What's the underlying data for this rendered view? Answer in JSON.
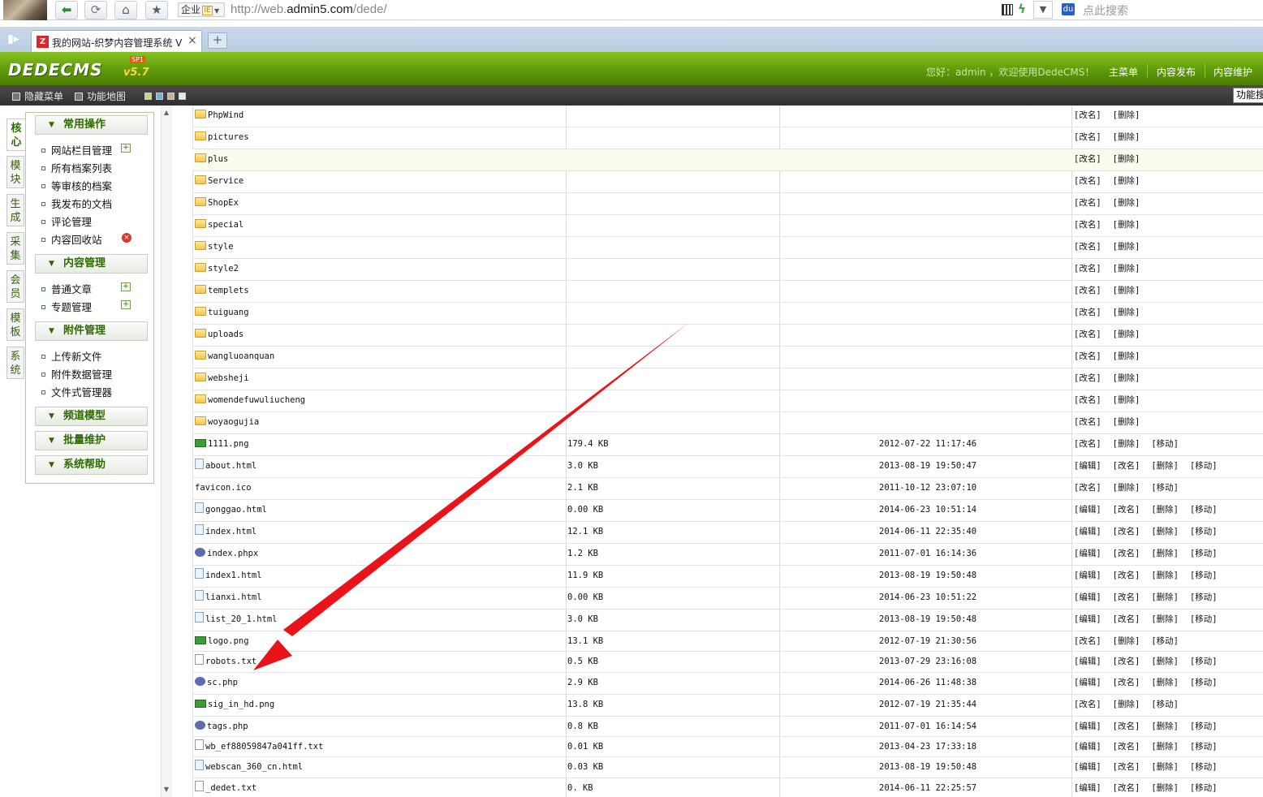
{
  "browser": {
    "url_prefix": "http://web.",
    "url_domain": "admin5.com",
    "url_suffix": "/dede/",
    "mode_label": "企业",
    "mode_ie": "IE",
    "search_placeholder": "点此搜索",
    "tab_title": "我的网站-织梦内容管理系统 V",
    "tab_close": "×",
    "new_tab": "+"
  },
  "header": {
    "logo": "DEDECMS",
    "version": "v5.7",
    "sp": "SP1",
    "welcome": "您好：admin ，欢迎使用DedeCMS！",
    "menus": [
      "主菜单",
      "内容发布",
      "内容维护"
    ]
  },
  "toolbar": {
    "hide_menu": "隐藏菜单",
    "func_map": "功能地图",
    "func_search": "功能搜",
    "skin_colors": [
      "#c8d86a",
      "#6eb4e6",
      "#c9b48a",
      "#e8e8e8"
    ]
  },
  "side_tabs": [
    "核心",
    "模块",
    "生成",
    "采集",
    "会员",
    "模板",
    "系统"
  ],
  "menu_groups": [
    {
      "title": "常用操作",
      "items": [
        "网站栏目管理",
        "所有档案列表",
        "等审核的档案",
        "我发布的文档",
        "评论管理",
        "内容回收站"
      ]
    },
    {
      "title": "内容管理",
      "items": [
        "普通文章",
        "专题管理"
      ]
    },
    {
      "title": "附件管理",
      "items": [
        "上传新文件",
        "附件数据管理",
        "文件式管理器"
      ]
    },
    {
      "title": "频道模型",
      "items": []
    },
    {
      "title": "批量维护",
      "items": []
    },
    {
      "title": "系统帮助",
      "items": []
    }
  ],
  "ops": {
    "edit": "[编辑]",
    "rename": "[改名]",
    "delete": "[删除]",
    "move": "[移动]"
  },
  "files": [
    {
      "name": "PhpWind",
      "type": "folder",
      "size": "",
      "date": "",
      "ops": [
        "rename",
        "delete"
      ]
    },
    {
      "name": "pictures",
      "type": "folder",
      "size": "",
      "date": "",
      "ops": [
        "rename",
        "delete"
      ]
    },
    {
      "name": "plus",
      "type": "folder",
      "size": "",
      "date": "",
      "ops": [
        "rename",
        "delete"
      ],
      "highlight": true
    },
    {
      "name": "Service",
      "type": "folder",
      "size": "",
      "date": "",
      "ops": [
        "rename",
        "delete"
      ]
    },
    {
      "name": "ShopEx",
      "type": "folder",
      "size": "",
      "date": "",
      "ops": [
        "rename",
        "delete"
      ]
    },
    {
      "name": "special",
      "type": "folder",
      "size": "",
      "date": "",
      "ops": [
        "rename",
        "delete"
      ]
    },
    {
      "name": "style",
      "type": "folder",
      "size": "",
      "date": "",
      "ops": [
        "rename",
        "delete"
      ]
    },
    {
      "name": "style2",
      "type": "folder",
      "size": "",
      "date": "",
      "ops": [
        "rename",
        "delete"
      ]
    },
    {
      "name": "templets",
      "type": "folder",
      "size": "",
      "date": "",
      "ops": [
        "rename",
        "delete"
      ]
    },
    {
      "name": "tuiguang",
      "type": "folder",
      "size": "",
      "date": "",
      "ops": [
        "rename",
        "delete"
      ]
    },
    {
      "name": "uploads",
      "type": "folder",
      "size": "",
      "date": "",
      "ops": [
        "rename",
        "delete"
      ]
    },
    {
      "name": "wangluoanquan",
      "type": "folder",
      "size": "",
      "date": "",
      "ops": [
        "rename",
        "delete"
      ]
    },
    {
      "name": "websheji",
      "type": "folder",
      "size": "",
      "date": "",
      "ops": [
        "rename",
        "delete"
      ]
    },
    {
      "name": "womendefuwuliucheng",
      "type": "folder",
      "size": "",
      "date": "",
      "ops": [
        "rename",
        "delete"
      ]
    },
    {
      "name": "woyaogujia",
      "type": "folder",
      "size": "",
      "date": "",
      "ops": [
        "rename",
        "delete"
      ]
    },
    {
      "name": "1111.png",
      "type": "gif",
      "size": "179.4 KB",
      "date": "2012-07-22 11:17:46",
      "ops": [
        "rename",
        "delete",
        "move"
      ]
    },
    {
      "name": "about.html",
      "type": "html",
      "size": "3.0 KB",
      "date": "2013-08-19 19:50:47",
      "ops": [
        "edit",
        "rename",
        "delete",
        "move"
      ]
    },
    {
      "name": "favicon.ico",
      "type": "none",
      "size": "2.1 KB",
      "date": "2011-10-12 23:07:10",
      "ops": [
        "rename",
        "delete",
        "move"
      ]
    },
    {
      "name": "gonggao.html",
      "type": "html",
      "size": "0.00 KB",
      "date": "2014-06-23 10:51:14",
      "ops": [
        "edit",
        "rename",
        "delete",
        "move"
      ]
    },
    {
      "name": "index.html",
      "type": "html",
      "size": "12.1 KB",
      "date": "2014-06-11 22:35:40",
      "ops": [
        "edit",
        "rename",
        "delete",
        "move"
      ]
    },
    {
      "name": "index.phpx",
      "type": "php",
      "size": "1.2 KB",
      "date": "2011-07-01 16:14:36",
      "ops": [
        "edit",
        "rename",
        "delete",
        "move"
      ]
    },
    {
      "name": "index1.html",
      "type": "html",
      "size": "11.9 KB",
      "date": "2013-08-19 19:50:48",
      "ops": [
        "edit",
        "rename",
        "delete",
        "move"
      ]
    },
    {
      "name": "lianxi.html",
      "type": "html",
      "size": "0.00 KB",
      "date": "2014-06-23 10:51:22",
      "ops": [
        "edit",
        "rename",
        "delete",
        "move"
      ]
    },
    {
      "name": "list_20_1.html",
      "type": "html",
      "size": "3.0 KB",
      "date": "2013-08-19 19:50:48",
      "ops": [
        "edit",
        "rename",
        "delete",
        "move"
      ]
    },
    {
      "name": "logo.png",
      "type": "gif",
      "size": "13.1 KB",
      "date": "2012-07-19 21:30:56",
      "ops": [
        "rename",
        "delete",
        "move"
      ]
    },
    {
      "name": "robots.txt",
      "type": "txt",
      "size": "0.5 KB",
      "date": "2013-07-29 23:16:08",
      "ops": [
        "edit",
        "rename",
        "delete",
        "move"
      ]
    },
    {
      "name": "sc.php",
      "type": "php",
      "size": "2.9 KB",
      "date": "2014-06-26 11:48:38",
      "ops": [
        "edit",
        "rename",
        "delete",
        "move"
      ]
    },
    {
      "name": "sig_in_hd.png",
      "type": "gif",
      "size": "13.8 KB",
      "date": "2012-07-19 21:35:44",
      "ops": [
        "rename",
        "delete",
        "move"
      ]
    },
    {
      "name": "tags.php",
      "type": "php",
      "size": "0.8 KB",
      "date": "2011-07-01 16:14:54",
      "ops": [
        "edit",
        "rename",
        "delete",
        "move"
      ]
    },
    {
      "name": "wb_ef88059847a041ff.txt",
      "type": "txt",
      "size": "0.01 KB",
      "date": "2013-04-23 17:33:18",
      "ops": [
        "edit",
        "rename",
        "delete",
        "move"
      ]
    },
    {
      "name": "webscan_360_cn.html",
      "type": "html",
      "size": "0.03 KB",
      "date": "2013-08-19 19:50:48",
      "ops": [
        "edit",
        "rename",
        "delete",
        "move"
      ]
    },
    {
      "name": "_dedet.txt",
      "type": "txt",
      "size": "0. KB",
      "date": "2014-06-11 22:25:57",
      "ops": [
        "edit",
        "rename",
        "delete",
        "move"
      ]
    }
  ],
  "colors": {
    "header_green": "#6aa812",
    "annotation_red": "#e8141a"
  }
}
